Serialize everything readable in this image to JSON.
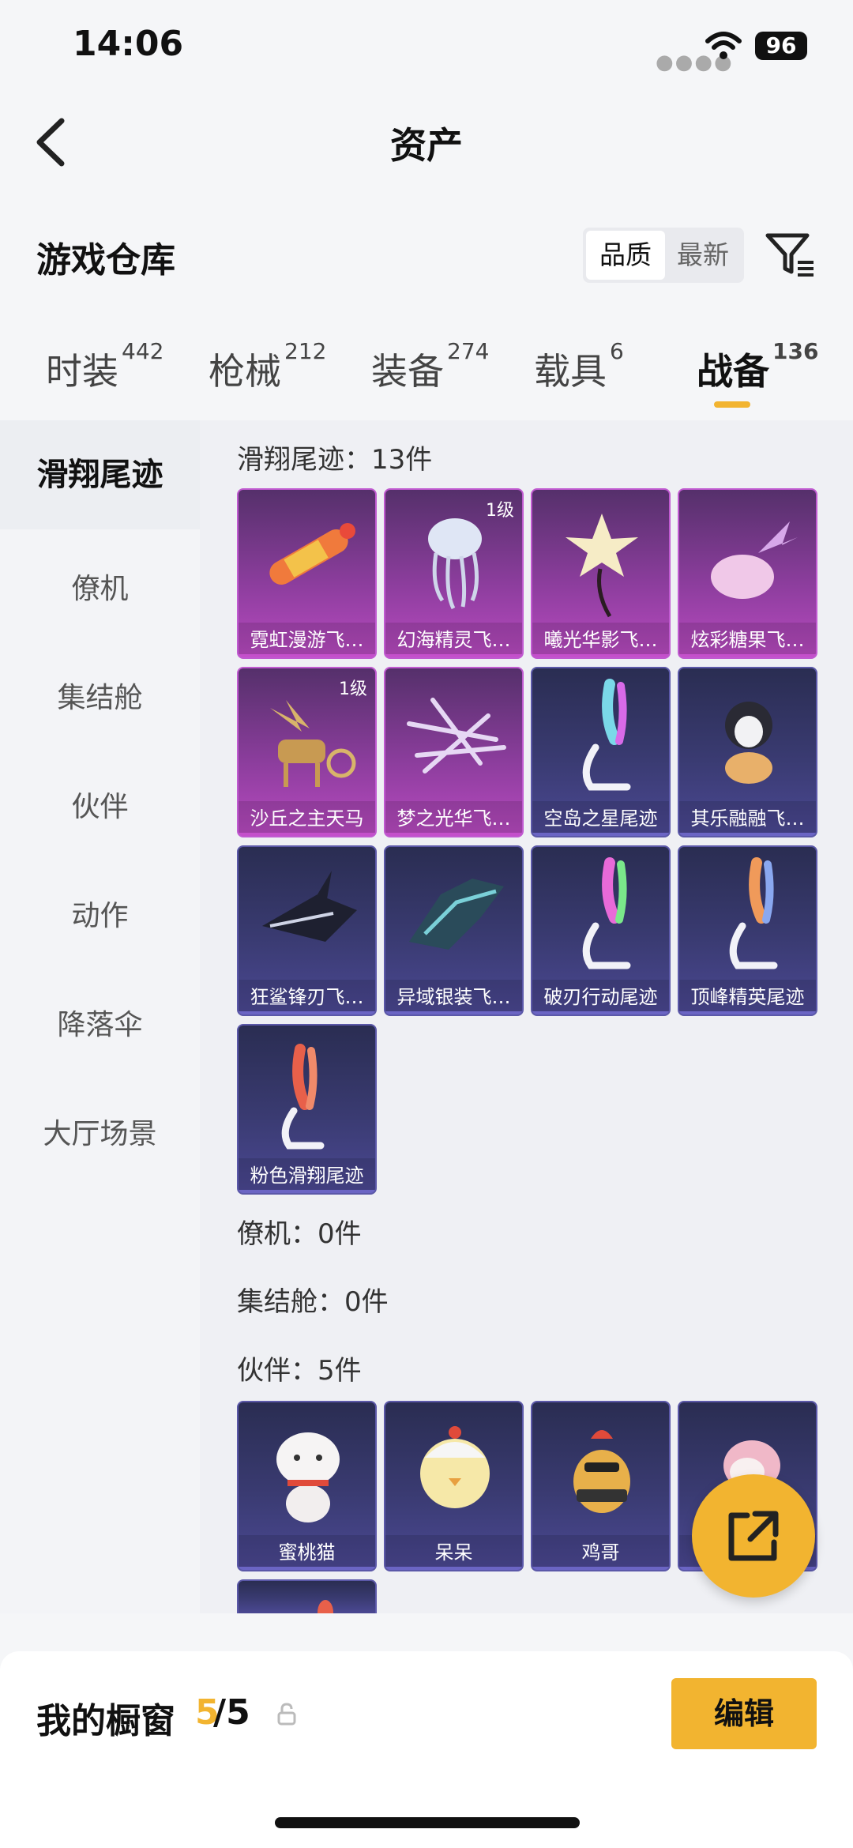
{
  "status": {
    "time": "14:06",
    "battery": "96"
  },
  "nav": {
    "title": "资产",
    "back_icon": "chevron-left-icon"
  },
  "header": {
    "title": "游戏仓库",
    "sort": {
      "options": [
        "品质",
        "最新"
      ],
      "selected": "品质"
    },
    "filter_icon": "filter-icon"
  },
  "tabs": [
    {
      "label": "时装",
      "count": "442"
    },
    {
      "label": "枪械",
      "count": "212"
    },
    {
      "label": "装备",
      "count": "274"
    },
    {
      "label": "载具",
      "count": "6"
    },
    {
      "label": "战备",
      "count": "136",
      "active": true
    }
  ],
  "sidebar": {
    "items": [
      {
        "label": "滑翔尾迹",
        "active": true
      },
      {
        "label": "僚机"
      },
      {
        "label": "集结舱"
      },
      {
        "label": "伙伴"
      },
      {
        "label": "动作"
      },
      {
        "label": "降落伞"
      },
      {
        "label": "大厅场景"
      }
    ]
  },
  "sections": {
    "trails": {
      "title": "滑翔尾迹：13件",
      "items": [
        {
          "name": "霓虹漫游飞…",
          "quality": "pink"
        },
        {
          "name": "幻海精灵飞…",
          "quality": "pink",
          "level": "1级"
        },
        {
          "name": "曦光华影飞…",
          "quality": "pink"
        },
        {
          "name": "炫彩糖果飞…",
          "quality": "pink"
        },
        {
          "name": "沙丘之主天马",
          "quality": "pink",
          "level": "1级"
        },
        {
          "name": "梦之光华飞…",
          "quality": "pink"
        },
        {
          "name": "空岛之星尾迹",
          "quality": "blue"
        },
        {
          "name": "其乐融融飞…",
          "quality": "blue"
        },
        {
          "name": "狂鲨锋刃飞…",
          "quality": "blue"
        },
        {
          "name": "异域银装飞…",
          "quality": "blue"
        },
        {
          "name": "破刃行动尾迹",
          "quality": "blue"
        },
        {
          "name": "顶峰精英尾迹",
          "quality": "blue"
        },
        {
          "name": "粉色滑翔尾迹",
          "quality": "blue"
        }
      ]
    },
    "wingman": {
      "title": "僚机：0件"
    },
    "capsule": {
      "title": "集结舱：0件"
    },
    "partners": {
      "title": "伙伴：5件",
      "items": [
        {
          "name": "蜜桃猫",
          "quality": "blue"
        },
        {
          "name": "呆呆",
          "quality": "blue"
        },
        {
          "name": "鸡哥",
          "quality": "blue"
        },
        {
          "name": "",
          "quality": "blue"
        }
      ]
    }
  },
  "fab_icon": "share-external-icon",
  "bottom": {
    "title": "我的橱窗",
    "count_current": "5",
    "count_rest": "/5",
    "lock_icon": "lock-icon",
    "edit_label": "编辑"
  },
  "colors": {
    "accent": "#f2b430",
    "pink_quality": "#b84ac0",
    "blue_quality": "#4b4893"
  }
}
